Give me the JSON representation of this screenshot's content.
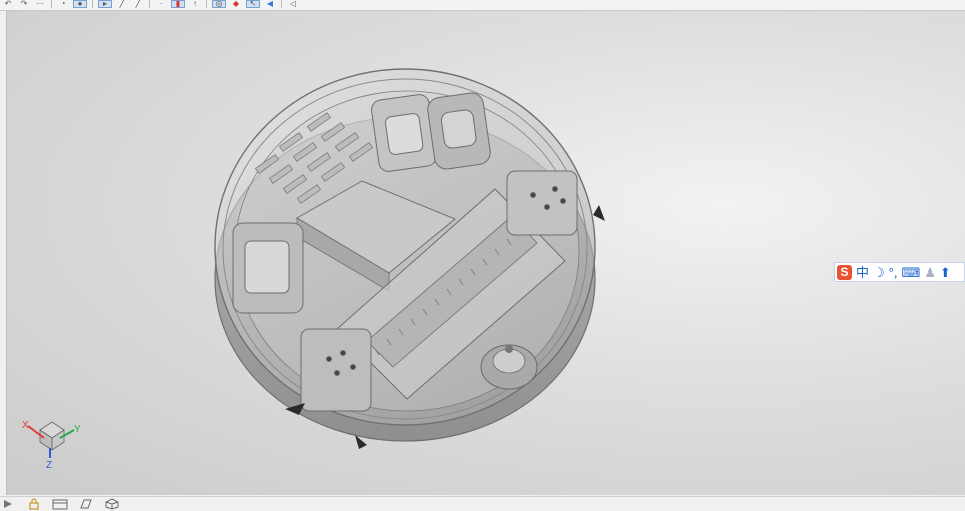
{
  "toolbar_top": {
    "icons": [
      "undo-icon",
      "redo-icon",
      "snap-icon",
      "view-orient-icon",
      "shaded-view-icon",
      "select-filter-icon",
      "sketch-line-icon",
      "curve-icon",
      "point-icon",
      "measure-icon",
      "rotate-icon",
      "gear-icon",
      "arrow-icon",
      "cursor-icon",
      "back-icon"
    ]
  },
  "triad": {
    "x_label": "X",
    "y_label": "Y",
    "z_label": "Z",
    "colors": {
      "x": "#e23a3a",
      "y": "#2aa84a",
      "z": "#2f5fd6"
    }
  },
  "ime_bar": {
    "logo": "S",
    "mode": "中",
    "moon": "☽",
    "punct": "°,",
    "keyboard": "⌨",
    "user": "♟",
    "arrow": "⬆",
    "logo_color": "#e8542f"
  },
  "toolbar_bottom": {
    "icons": [
      "play-icon",
      "lock-icon",
      "sheet-icon",
      "layer-icon",
      "cube-icon"
    ]
  }
}
